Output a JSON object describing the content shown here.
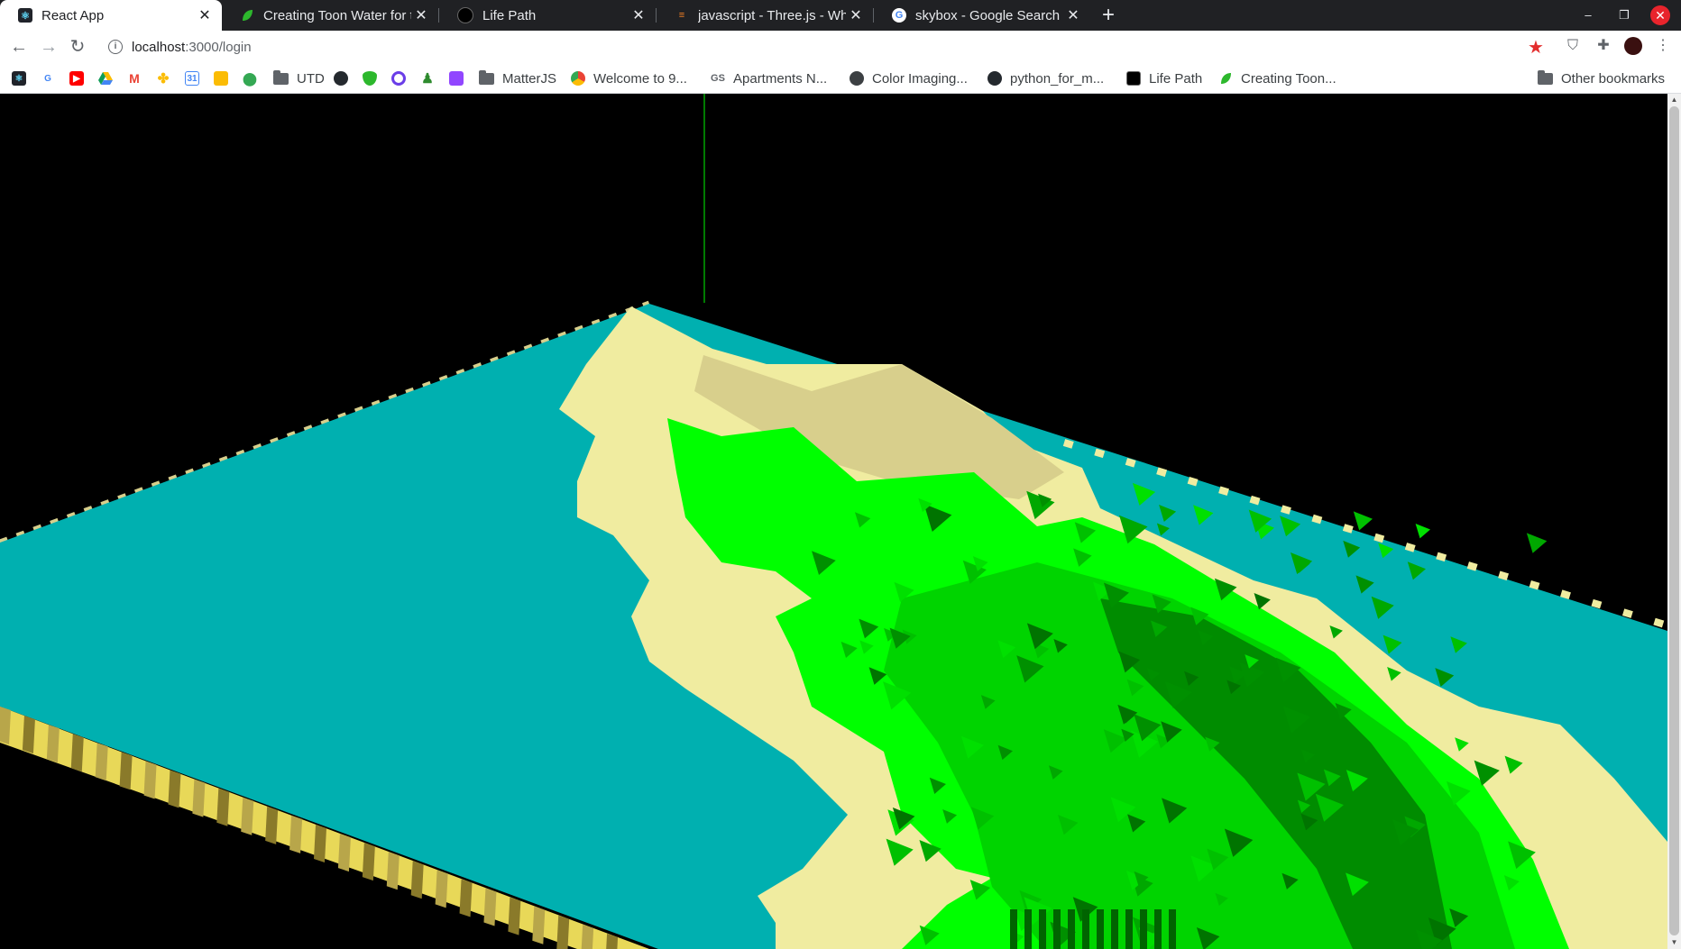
{
  "tabs": [
    {
      "title": "React App",
      "active": true,
      "favicon": "react-icon"
    },
    {
      "title": "Creating Toon Water for t",
      "active": false,
      "favicon": "leaf-icon"
    },
    {
      "title": "Life Path",
      "active": false,
      "favicon": "lifepath-icon"
    },
    {
      "title": "javascript - Three.js - Wha",
      "active": false,
      "favicon": "stackoverflow-icon"
    },
    {
      "title": "skybox - Google Search",
      "active": false,
      "favicon": "google-icon"
    }
  ],
  "address_bar": {
    "host": "localhost",
    "path": ":3000/login"
  },
  "bookmarks": {
    "items": [
      {
        "label": "UTD",
        "icon": "folder-icon"
      },
      {
        "label": "MatterJS",
        "icon": "folder-icon"
      },
      {
        "label": "Welcome to 9...",
        "icon": "chrome-icon"
      },
      {
        "label": "Apartments N...",
        "icon": "gs-icon"
      },
      {
        "label": "Color Imaging...",
        "icon": "globe-icon"
      },
      {
        "label": "python_for_m...",
        "icon": "github-icon"
      },
      {
        "label": "Life Path",
        "icon": "lifepath-icon"
      },
      {
        "label": "Creating Toon...",
        "icon": "leaf-icon"
      }
    ],
    "other": "Other bookmarks"
  },
  "colors": {
    "water": "#00b0b0",
    "sand_light": "#f0eca0",
    "sand": "#d8cf8c",
    "grass_bright": "#00ff00",
    "grass_mid": "#00d400",
    "grass_dark": "#008c00",
    "cliff_yellow": "#e8d858",
    "axis_line": "#00cc00"
  }
}
